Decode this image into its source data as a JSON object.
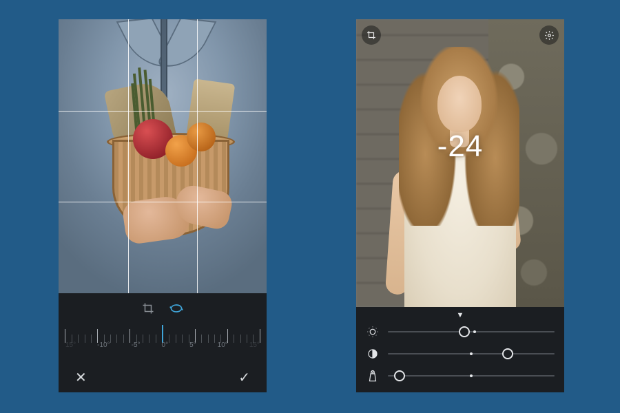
{
  "left": {
    "mode_icons": {
      "crop": "crop-icon",
      "rotate": "rotate-icon",
      "active": "rotate"
    },
    "dial": {
      "labels": [
        "15°",
        "-10°",
        "-5°",
        "0°",
        "5°",
        "10°",
        "15°"
      ],
      "current": "0°"
    },
    "actions": {
      "cancel": "✕",
      "confirm": "✓"
    }
  },
  "right": {
    "top": {
      "crop": "crop-icon",
      "settings": "gear-icon"
    },
    "value": "-24",
    "caret": "▼",
    "sliders": [
      {
        "name": "exposure",
        "icon": "sun-icon",
        "position": 0.46,
        "default": 0.52
      },
      {
        "name": "contrast",
        "icon": "contrast-icon",
        "position": 0.72,
        "default": 0.5
      },
      {
        "name": "saturation",
        "icon": "salt-icon",
        "position": 0.07,
        "default": 0.5
      }
    ]
  }
}
